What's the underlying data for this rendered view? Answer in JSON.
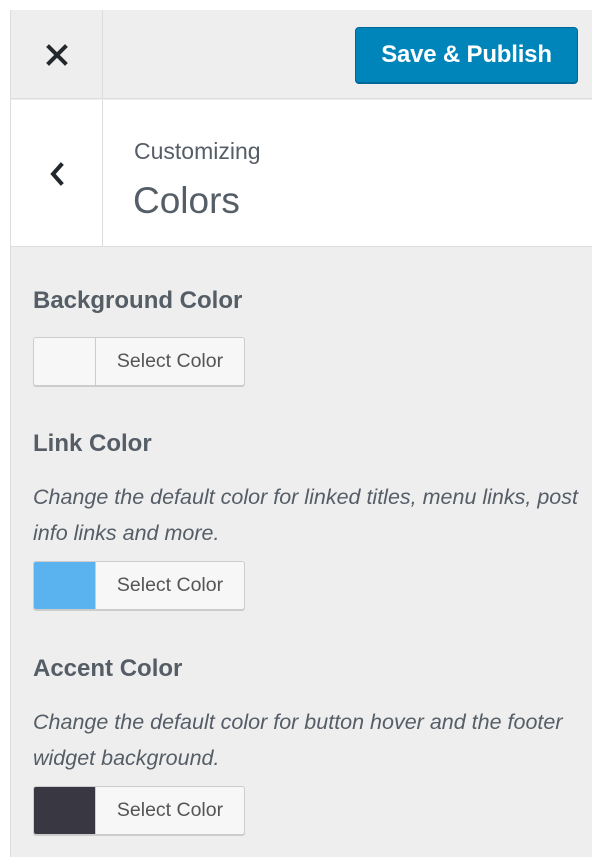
{
  "header": {
    "close_icon": "close-icon",
    "save_label": "Save & Publish",
    "accent_color": "#0085ba"
  },
  "section": {
    "back_icon": "chevron-left-icon",
    "breadcrumb": "Customizing",
    "title": "Colors"
  },
  "controls": [
    {
      "label": "Background Color",
      "description": "",
      "button_label": "Select Color",
      "swatch_color": "#f7f7f7"
    },
    {
      "label": "Link Color",
      "description": "Change the default color for linked titles, menu links, post info links and more.",
      "button_label": "Select Color",
      "swatch_color": "#5ab3ef"
    },
    {
      "label": "Accent Color",
      "description": "Change the default color for button hover and the footer widget background.",
      "button_label": "Select Color",
      "swatch_color": "#383742"
    }
  ]
}
